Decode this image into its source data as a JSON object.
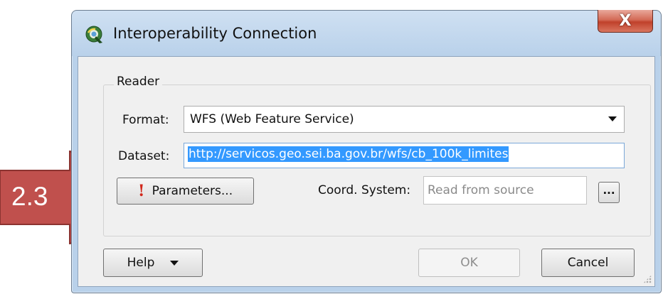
{
  "window": {
    "title": "Interoperability Connection",
    "close_label": "X"
  },
  "reader": {
    "group_label": "Reader",
    "format_label": "Format:",
    "format_value": "WFS (Web Feature Service)",
    "dataset_label": "Dataset:",
    "dataset_value": "http://servicos.geo.sei.ba.gov.br/wfs/cb_100k_limites",
    "parameters_label": "Parameters...",
    "coord_label": "Coord. System:",
    "coord_placeholder": "Read from source",
    "ellipsis_label": "..."
  },
  "footer": {
    "help_label": "Help",
    "ok_label": "OK",
    "cancel_label": "Cancel"
  },
  "annotation": {
    "step_label": "2.3",
    "arrow_color": "#c0504d"
  },
  "icons": {
    "app": "qgis-icon",
    "parameters": "exclamation-icon",
    "dropdown": "chevron-down-icon"
  },
  "colors": {
    "titlebar": "#b9d1ea",
    "close_button": "#c0412b",
    "selection": "#3399ff",
    "warning": "#d1281c"
  }
}
